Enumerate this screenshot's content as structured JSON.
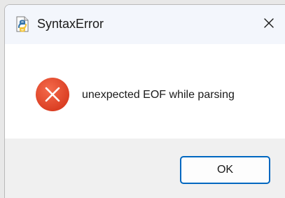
{
  "window": {
    "title": "SyntaxError",
    "app_icon": "python-script-icon",
    "close_icon": "close-icon"
  },
  "message": {
    "icon": "error-icon",
    "text": "unexpected EOF while parsing"
  },
  "buttons": {
    "ok_label": "OK"
  },
  "colors": {
    "error_red": "#e3442a",
    "accent_blue": "#0067c0",
    "titlebar_bg": "#f3f6fc",
    "footer_bg": "#f0f0f0"
  }
}
